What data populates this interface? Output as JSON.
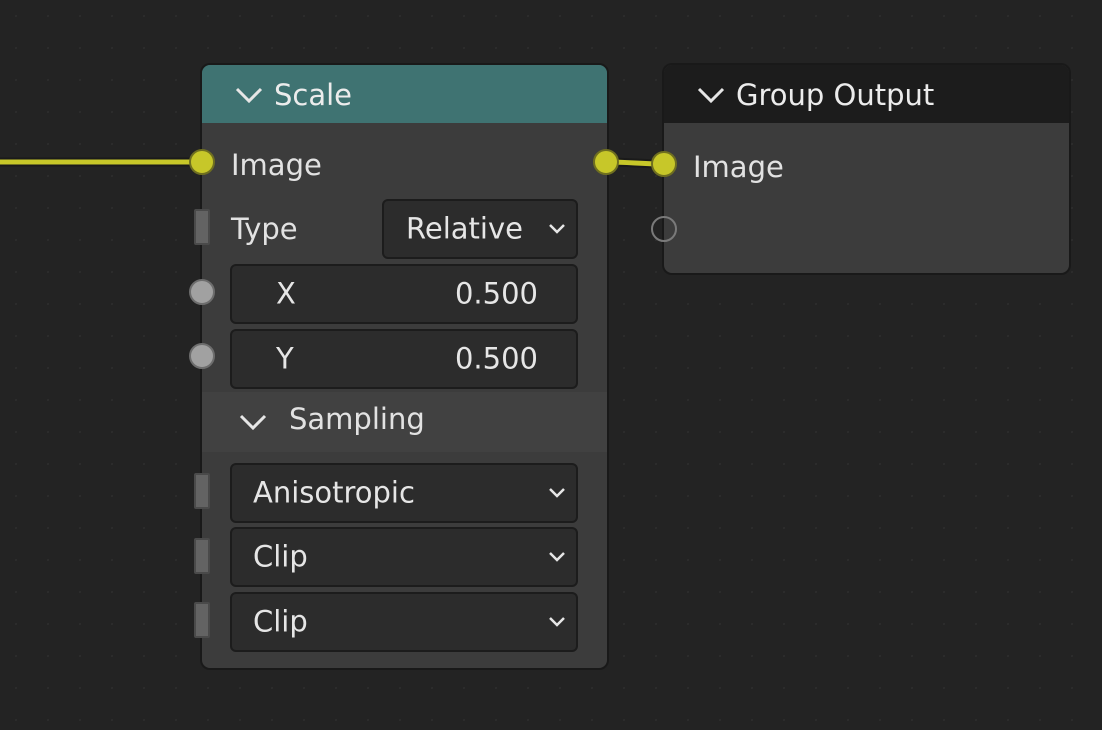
{
  "colors": {
    "scale_header": "#3f7372",
    "group_output_header": "#1c1c1c",
    "image_socket": "#c7c729",
    "value_socket": "#a1a1a1",
    "link": "#c7c729"
  },
  "scale_node": {
    "title": "Scale",
    "image_output_label": "Image",
    "type_label": "Type",
    "type_value": "Relative",
    "x_label": "X",
    "x_value": "0.500",
    "y_label": "Y",
    "y_value": "0.500",
    "sampling_panel_label": "Sampling",
    "filter_value": "Anisotropic",
    "extension_x_value": "Clip",
    "extension_y_value": "Clip"
  },
  "group_output_node": {
    "title": "Group Output",
    "image_input_label": "Image"
  },
  "icons": {
    "collapse": "chevron-down-icon",
    "dropdown": "chevron-down-icon"
  }
}
